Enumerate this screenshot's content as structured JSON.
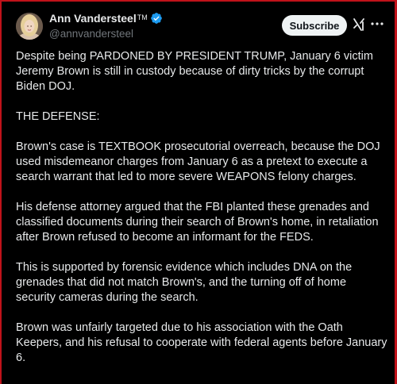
{
  "author": {
    "name": "Ann Vandersteel",
    "tm": "TM",
    "handle": "@annvandersteel"
  },
  "actions": {
    "subscribe_label": "Subscribe",
    "grok_icon": "grok-icon",
    "more_icon": "more-icon"
  },
  "colors": {
    "background": "#000000",
    "text": "#e7e9ea",
    "muted": "#71767b",
    "verified": "#1d9bf0",
    "border": "#c0121a"
  },
  "post": {
    "paragraphs": [
      "Despite being PARDONED BY PRESIDENT TRUMP, January 6 victim Jeremy Brown is still in custody because of dirty tricks by the corrupt Biden DOJ.",
      "THE DEFENSE:",
      "Brown's case is TEXTBOOK prosecutorial overreach, because the DOJ used misdemeanor charges from January 6 as a pretext to execute a search warrant that led to more severe WEAPONS felony charges.",
      "His defense attorney argued that the FBI planted these grenades and classified documents during their search of Brown's home, in retaliation after Brown refused to become an informant for the FEDS.",
      "This is supported by forensic evidence which includes DNA on the grenades that did not match Brown's, and the turning off of home security cameras during the search.",
      "Brown was unfairly targeted due to his association with the Oath Keepers, and his refusal to cooperate with federal agents before January 6."
    ]
  }
}
